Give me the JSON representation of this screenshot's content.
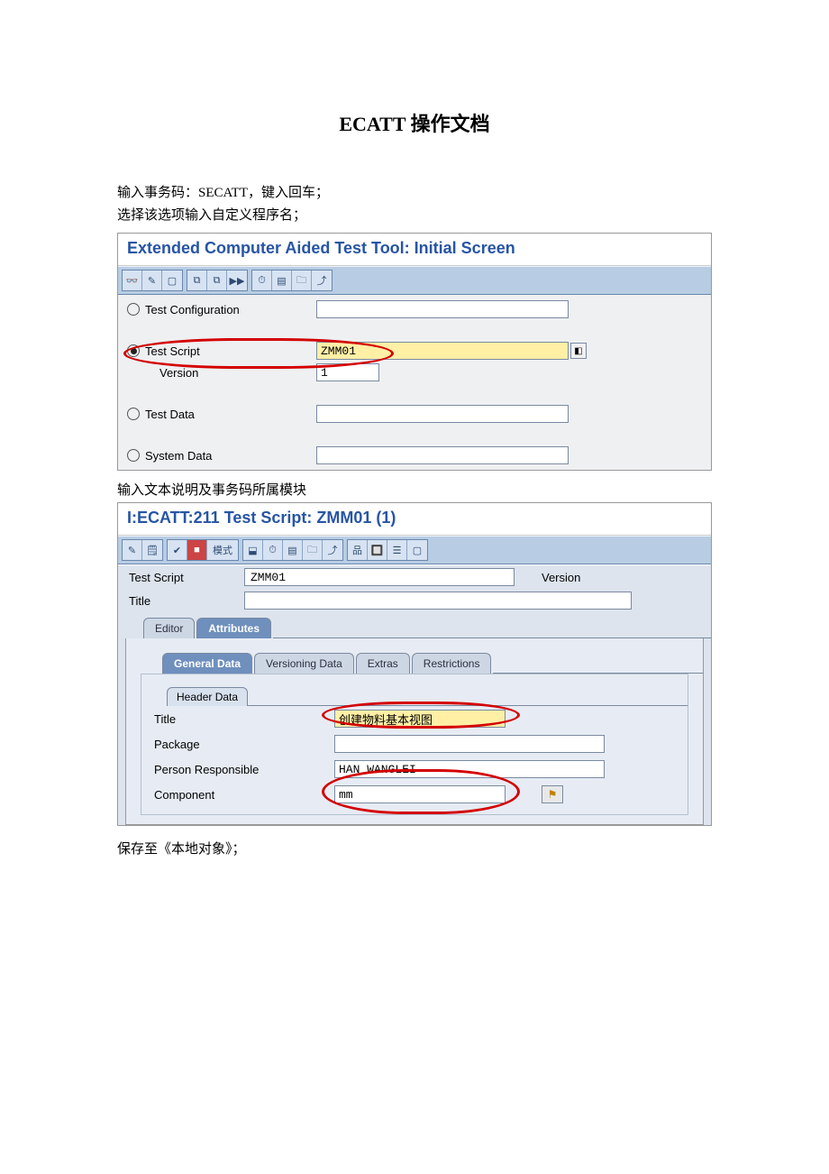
{
  "doc": {
    "title": "ECATT 操作文档",
    "p1": "输入事务码：SECATT，键入回车；",
    "p2": "选择该选项输入自定义程序名；",
    "p3": "输入文本说明及事务码所属模块",
    "p4": "保存至《本地对象》；"
  },
  "screen1": {
    "title": "Extended Computer Aided Test Tool: Initial Screen",
    "radios": {
      "test_config": "Test Configuration",
      "test_script": "Test Script",
      "version_label": "Version",
      "test_data": "Test Data",
      "system_data": "System Data"
    },
    "values": {
      "test_script": "ZMM01",
      "version": "1"
    }
  },
  "screen2": {
    "title": "I:ECATT:211 Test Script: ZMM01 (1)",
    "mode_btn": "模式",
    "labels": {
      "test_script": "Test Script",
      "title": "Title",
      "version": "Version"
    },
    "tabs": {
      "editor": "Editor",
      "attributes": "Attributes"
    },
    "subtabs": {
      "general": "General Data",
      "versioning": "Versioning Data",
      "extras": "Extras",
      "restrictions": "Restrictions"
    },
    "group": {
      "header": "Header Data",
      "title_label": "Title",
      "package_label": "Package",
      "person_label": "Person Responsible",
      "component_label": "Component"
    },
    "values": {
      "test_script": "ZMM01",
      "title_val": "创建物料基本视图",
      "person": "HAN_WANGLEI",
      "component": "mm"
    }
  }
}
